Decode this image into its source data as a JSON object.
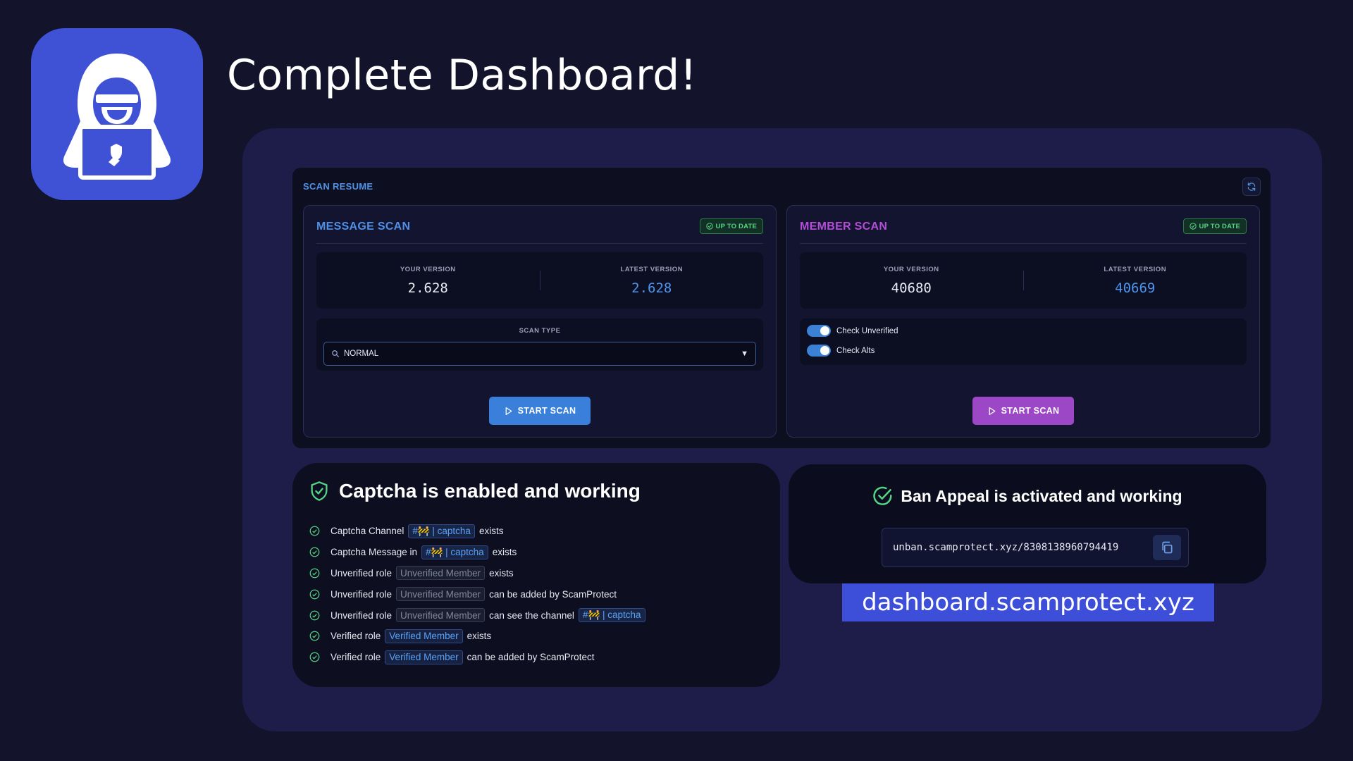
{
  "headline": "Complete Dashboard!",
  "scan_resume": {
    "title": "SCAN RESUME",
    "message_scan": {
      "title": "MESSAGE SCAN",
      "badge": "UP TO DATE",
      "your_version_label": "YOUR VERSION",
      "your_version": "2.628",
      "latest_version_label": "LATEST VERSION",
      "latest_version": "2.628",
      "scan_type_label": "SCAN TYPE",
      "scan_type_value": "NORMAL",
      "start_label": "START SCAN"
    },
    "member_scan": {
      "title": "MEMBER SCAN",
      "badge": "UP TO DATE",
      "your_version_label": "YOUR VERSION",
      "your_version": "40680",
      "latest_version_label": "LATEST VERSION",
      "latest_version": "40669",
      "toggles": [
        {
          "label": "Check Unverified",
          "on": true
        },
        {
          "label": "Check Alts",
          "on": true
        }
      ],
      "start_label": "START SCAN"
    }
  },
  "captcha": {
    "title": "Captcha is enabled and working",
    "items": [
      {
        "pre": "Captcha Channel",
        "chip": "#🚧 | captcha",
        "post": "exists"
      },
      {
        "pre": "Captcha Message in",
        "chip": "#🚧 | captcha",
        "post": "exists"
      },
      {
        "pre": "Unverified role",
        "chip": "Unverified Member",
        "post": "exists"
      },
      {
        "pre": "Unverified role",
        "chip": "Unverified Member",
        "post": "can be added by ScamProtect"
      },
      {
        "pre": "Unverified role",
        "chip": "Unverified Member",
        "mid": "can see the channel",
        "chip2": "#🚧 | captcha"
      },
      {
        "pre": "Verified role",
        "chip": "Verified Member",
        "post": "exists"
      },
      {
        "pre": "Verified role",
        "chip": "Verified Member",
        "post": "can be added by ScamProtect"
      }
    ]
  },
  "ban_appeal": {
    "title": "Ban Appeal is activated and working",
    "url": "unban.scamprotect.xyz/8308138960794419"
  },
  "domain_banner": "dashboard.scamprotect.xyz",
  "colors": {
    "accent_blue": "#4f8fe6",
    "accent_purple": "#b24fd6",
    "success_green": "#53d583",
    "brand": "#3f52d6"
  }
}
